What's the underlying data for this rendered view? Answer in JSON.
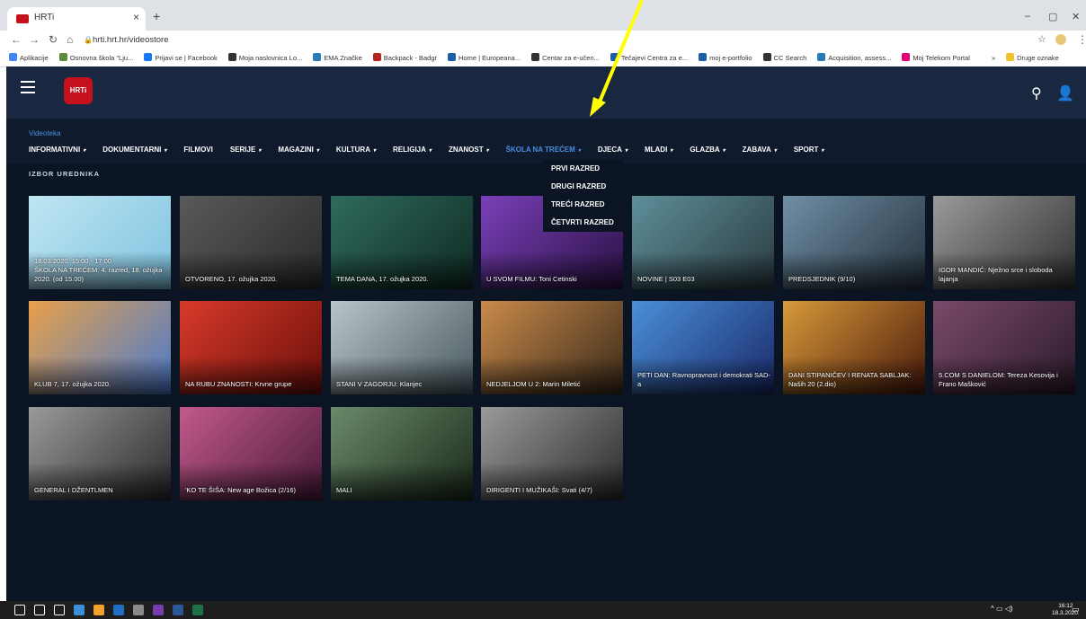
{
  "browser": {
    "tab_title": "HRTi",
    "url": "hrti.hrt.hr/videostore",
    "bookmarks": [
      {
        "label": "Aplikacije",
        "color": "#4285f4"
      },
      {
        "label": "Osnovna škola \"Lju...",
        "color": "#5c8a3a"
      },
      {
        "label": "Prijavi se | Facebook",
        "color": "#1877f2"
      },
      {
        "label": "Moja naslovnica Lo...",
        "color": "#333333"
      },
      {
        "label": "EMA Značke",
        "color": "#2a7ab8"
      },
      {
        "label": "Backpack - Badgr",
        "color": "#b3261e"
      },
      {
        "label": "Home | Europeana...",
        "color": "#1c5fa8"
      },
      {
        "label": "Centar za e-učen...",
        "color": "#333333"
      },
      {
        "label": "Tečajevi Centra za e...",
        "color": "#1c5fa8"
      },
      {
        "label": "moj e-portfolio",
        "color": "#1c5fa8"
      },
      {
        "label": "CC Search",
        "color": "#333333"
      },
      {
        "label": "Acquisition, assess...",
        "color": "#2a7ab8"
      },
      {
        "label": "Moj Telekom Portal",
        "color": "#e20074"
      },
      {
        "label": "»",
        "color": "#ffffff"
      },
      {
        "label": "Druge oznake",
        "color": "#f2c12e"
      }
    ]
  },
  "site": {
    "logo_text": "HRTi",
    "breadcrumb": "Videoteka",
    "section_title": "IZBOR UREDNIKA",
    "menu": [
      {
        "label": "INFORMATIVNI",
        "chevron": true,
        "active": false
      },
      {
        "label": "DOKUMENTARNI",
        "chevron": true,
        "active": false
      },
      {
        "label": "FILMOVI",
        "chevron": false,
        "active": false
      },
      {
        "label": "SERIJE",
        "chevron": true,
        "active": false
      },
      {
        "label": "MAGAZINI",
        "chevron": true,
        "active": false
      },
      {
        "label": "KULTURA",
        "chevron": true,
        "active": false
      },
      {
        "label": "RELIGIJA",
        "chevron": true,
        "active": false
      },
      {
        "label": "ZNANOST",
        "chevron": true,
        "active": false
      },
      {
        "label": "ŠKOLA NA TREĆEM",
        "chevron": true,
        "active": true
      },
      {
        "label": "DJECA",
        "chevron": true,
        "active": false
      },
      {
        "label": "MLADI",
        "chevron": true,
        "active": false
      },
      {
        "label": "GLAZBA",
        "chevron": true,
        "active": false
      },
      {
        "label": "ZABAVA",
        "chevron": true,
        "active": false
      },
      {
        "label": "SPORT",
        "chevron": true,
        "active": false
      }
    ],
    "dropdown": [
      "PRVI RAZRED",
      "DRUGI RAZRED",
      "TREĆI RAZRED",
      "ČETVRTI RAZRED"
    ],
    "cards": [
      {
        "caption": "18.03.2020. 15:00 - 17:00\nŠKOLA NA TREĆEM: 4. razred, 18. ožujka 2020. (od 15.00)",
        "colors": [
          "#bfe6f2",
          "#7fc3e0"
        ]
      },
      {
        "caption": "OTVORENO, 17. ožujka 2020.",
        "colors": [
          "#5a5a5a",
          "#2a2a2a"
        ]
      },
      {
        "caption": "TEMA DANA, 17. ožujka 2020.",
        "colors": [
          "#2f6b5c",
          "#0f2a24"
        ]
      },
      {
        "caption": "U SVOM FILMU: Toni Cetinski",
        "colors": [
          "#7a3fb8",
          "#2a1245"
        ]
      },
      {
        "caption": "NOVINE | S03 E03",
        "colors": [
          "#5e8f9a",
          "#2a3b40"
        ]
      },
      {
        "caption": "PREDSJEDNIK (9/10)",
        "colors": [
          "#6f8fa6",
          "#25313c"
        ]
      },
      {
        "caption": "IGOR MANDIĆ: Nježno srce i sloboda lajanja",
        "colors": [
          "#9a9a9a",
          "#303030"
        ]
      },
      {
        "caption": "KLUB 7, 17. ožujka 2020.",
        "colors": [
          "#e8a04a",
          "#4a7ad0"
        ]
      },
      {
        "caption": "NA RUBU ZNANOSTI: Krvne grupe",
        "colors": [
          "#d83a2a",
          "#6a0f0a"
        ]
      },
      {
        "caption": "STANI V ZAGORJU: Klanjec",
        "colors": [
          "#b8c4c8",
          "#4a5a60"
        ]
      },
      {
        "caption": "NEDJELJOM U 2: Marin Miletić",
        "colors": [
          "#c98a4a",
          "#3a2a1a"
        ]
      },
      {
        "caption": "PETI DAN: Ravnopravnost i demokrati SAD-a",
        "colors": [
          "#4a8fd8",
          "#1a2a6a"
        ]
      },
      {
        "caption": "DANI STIPANIČEV I RENATA SABLJAK: Naših 20 (2.dio)",
        "colors": [
          "#d89a3a",
          "#4a1a0a"
        ]
      },
      {
        "caption": "5.COM S DANIELOM: Tereza Kesovija i Frano Mašković",
        "colors": [
          "#7a4a6a",
          "#2a1a2a"
        ]
      },
      {
        "caption": "GENERAL I DŽENTLMEN",
        "colors": [
          "#9a9a9a",
          "#2a2a2a"
        ]
      },
      {
        "caption": "'KO TE ŠIŠA: New age Božica (2/16)",
        "colors": [
          "#c25a8a",
          "#4a1a3a"
        ]
      },
      {
        "caption": "MALI",
        "colors": [
          "#6a8a6a",
          "#1a2a1a"
        ]
      },
      {
        "caption": "DIRIGENTI I MUŽIKAŠI: Svati (4/7)",
        "colors": [
          "#9a9a9a",
          "#2a2a2a"
        ]
      }
    ]
  },
  "taskbar": {
    "time": "16:12",
    "date": "18.3.2020.",
    "apps": [
      {
        "name": "windows-start-icon",
        "color": "#ffffff"
      },
      {
        "name": "search-icon",
        "color": "#ffffff"
      },
      {
        "name": "task-view-icon",
        "color": "#ffffff"
      },
      {
        "name": "mail-icon",
        "color": "#3b8fd8"
      },
      {
        "name": "chrome-icon",
        "color": "#f2a02e"
      },
      {
        "name": "outlook-icon",
        "color": "#1f6fc5"
      },
      {
        "name": "calculator-icon",
        "color": "#8a8a8a"
      },
      {
        "name": "onenote-icon",
        "color": "#7a3ab0"
      },
      {
        "name": "word-icon",
        "color": "#2b5797"
      },
      {
        "name": "excel-icon",
        "color": "#1e7145"
      }
    ]
  }
}
